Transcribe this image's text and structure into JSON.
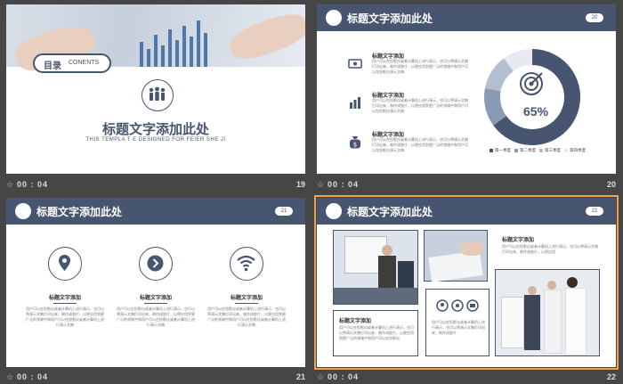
{
  "colors": {
    "navy": "#475570",
    "background": "#464646",
    "highlight": "#f0a24a"
  },
  "slide19": {
    "toc_cn": "目录",
    "toc_en": "CONENTS",
    "title": "标题文字添加此处",
    "subtitle": "THIS TEMPLA T E DESIGNED FOR FEIER SHE JI",
    "icon": "team-icon",
    "footer": {
      "time": "00 : 04",
      "num": "19"
    }
  },
  "slide20": {
    "header_title": "标题文字添加此处",
    "page_pill": "20",
    "rows": [
      {
        "icon": "money-icon",
        "title": "标题文字添加",
        "text": "用户可以在投影仪或者计算机上进行演示，也可以将演示文稿打印出来，制作成胶片，以便应用到更广泛的领域中和用户可以在投影仪演示文稿"
      },
      {
        "icon": "chart-icon",
        "title": "标题文字添加",
        "text": "用户可以在投影仪或者计算机上进行演示，也可以将演示文稿打印出来，制作成胶片，以便应用到更广泛的领域中和用户可以在投影仪演示文稿"
      },
      {
        "icon": "money-bag-icon",
        "title": "标题文字添加",
        "text": "用户可以在投影仪或者计算机上进行演示，也可以将演示文稿打印出来，制作成胶片，以便应用到更广泛的领域中和用户可以在投影仪演示文稿"
      }
    ],
    "chart_data": {
      "type": "pie",
      "center_label": "65%",
      "categories": [
        "第一季度",
        "第二季度",
        "第三季度",
        "第四季度"
      ],
      "values": [
        65,
        13,
        12,
        10
      ],
      "colors": [
        "#475570",
        "#8a9ab4",
        "#b3bfd1",
        "#e6eaf0"
      ]
    },
    "footer": {
      "time": "00 : 04",
      "num": "20"
    }
  },
  "slide21": {
    "header_title": "标题文字添加此处",
    "page_pill": "21",
    "columns": [
      {
        "icon": "location-pin-icon",
        "title": "标题文字添加",
        "text": "用户可以在投影仪或者计算机上进行演示，也可以将演示文稿打印出来，制作成胶片，以便应用到更广泛的领域中和用户可以在投影仪或者计算机上进行演示文稿"
      },
      {
        "icon": "arrow-right-circle-icon",
        "title": "标题文字添加",
        "text": "用户可以在投影仪或者计算机上进行演示，也可以将演示文稿打印出来，制作成胶片，以便应用到更广泛的领域中和用户可以在投影仪或者计算机上进行演示文稿"
      },
      {
        "icon": "wifi-icon",
        "title": "标题文字添加",
        "text": "用户可以在投影仪或者计算机上进行演示，也可以将演示文稿打印出来，制作成胶片，以便应用到更广泛的领域中和用户可以在投影仪或者计算机上进行演示文稿"
      }
    ],
    "footer": {
      "time": "00 : 04",
      "num": "21"
    }
  },
  "slide22": {
    "header_title": "标题文字添加此处",
    "page_pill": "22",
    "right_title": "标题文字添加",
    "right_text": "用户可以在投影仪或者计算机上进行演示，也可以将演示文稿打印出来，制作成胶片，以便应用",
    "left_title": "标题文字添加",
    "left_text": "用户可以在投影仪或者计算机上进行演示，也可以将演示文稿打印出来，制作成胶片，以便应用到更广泛的领域中和用户可以在投影仪",
    "mid_text": "用户可以在投影仪或者计算机上进行演示，也可以将演示文稿打印出来，制作成胶片",
    "footer": {
      "time": "00 : 04",
      "num": "22"
    }
  }
}
